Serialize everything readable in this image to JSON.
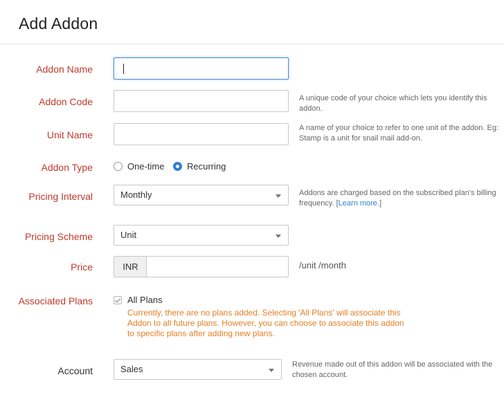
{
  "header": {
    "title": "Add Addon"
  },
  "form": {
    "addon_name": {
      "label": "Addon Name",
      "value": ""
    },
    "addon_code": {
      "label": "Addon Code",
      "value": "",
      "hint": "A unique code of your choice which lets you identify this addon."
    },
    "unit_name": {
      "label": "Unit Name",
      "value": "",
      "hint": "A name of your choice to refer to one unit of the addon. Eg: Stamp is a unit for snail mail add-on."
    },
    "addon_type": {
      "label": "Addon Type",
      "options": [
        "One-time",
        "Recurring"
      ],
      "selected": "Recurring"
    },
    "pricing_interval": {
      "label": "Pricing Interval",
      "value": "Monthly",
      "hint": "Addons are charged based on the subscribed plan's billing frequency. [",
      "hint_link": "Learn more.",
      "hint_end": "]"
    },
    "pricing_scheme": {
      "label": "Pricing Scheme",
      "value": "Unit"
    },
    "price": {
      "label": "Price",
      "currency": "INR",
      "value": "",
      "unit": "/unit /month"
    },
    "associated_plans": {
      "label": "Associated Plans",
      "checkbox_label": "All Plans",
      "checked": true,
      "warning": "Currently, there are no plans added. Selecting 'All Plans' will associate this Addon to all future plans. However, you can choose to associate this addon to specific plans after adding new plans."
    },
    "account": {
      "label": "Account",
      "value": "Sales",
      "hint": "Revenue made out of this addon will be associated with the chosen account."
    }
  },
  "colors": {
    "label_required": "#c0392b",
    "accent": "#2f7fd3",
    "warning": "#e67e22"
  }
}
